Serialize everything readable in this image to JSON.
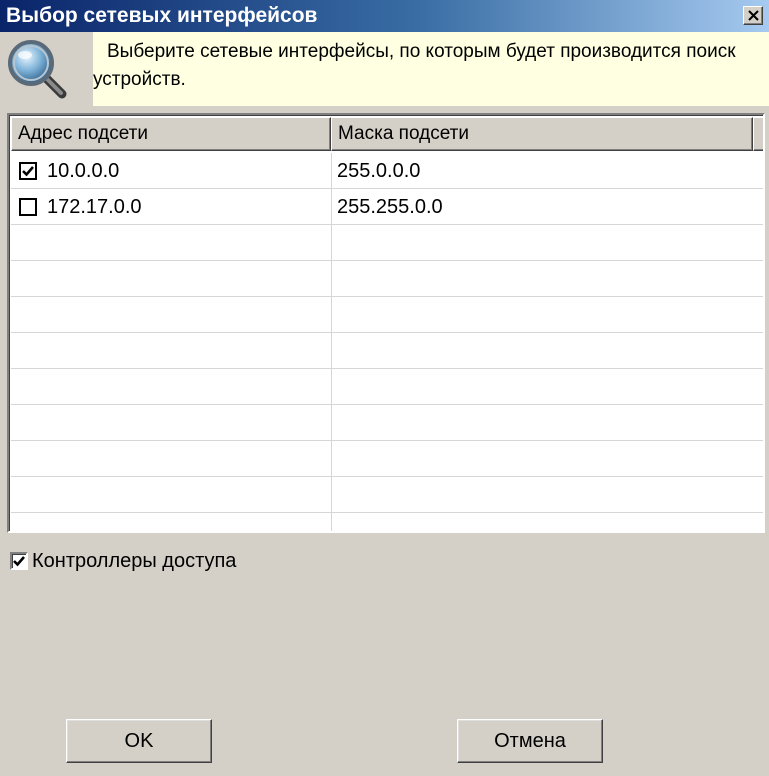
{
  "window": {
    "title": "Выбор сетевых интерфейсов",
    "close_label": "×"
  },
  "info": {
    "text": "Выберите сетевые интерфейсы,  по которым будет производится поиск устройств.",
    "icon": "magnifier-icon",
    "background": "#ffffe1"
  },
  "table": {
    "columns": [
      "Адрес подсети",
      "Маска подсети"
    ],
    "rows": [
      {
        "address": "10.0.0.0",
        "mask": "255.0.0.0",
        "checked": true
      },
      {
        "address": "172.17.0.0",
        "mask": "255.255.0.0",
        "checked": false
      }
    ]
  },
  "options": {
    "access_controllers_label": "Контроллеры доступа",
    "access_controllers_checked": true
  },
  "buttons": {
    "ok_label": "OK",
    "cancel_label": "Отмена"
  },
  "colors": {
    "title_start": "#0a246a",
    "title_end": "#a6caf0",
    "dialog_bg": "#d4d0c8"
  }
}
